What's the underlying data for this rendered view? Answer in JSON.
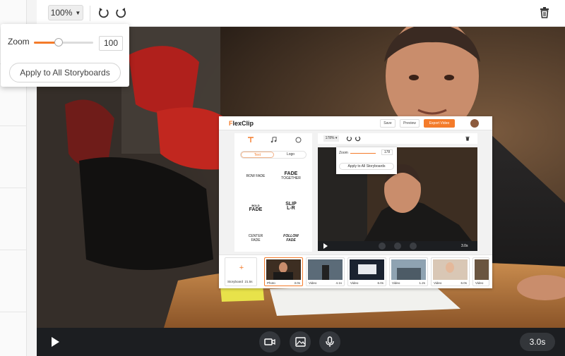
{
  "toolbar": {
    "zoom_display": "100%",
    "undo_icon": "undo-icon",
    "redo_icon": "redo-icon",
    "delete_icon": "trash-icon"
  },
  "zoom_popup": {
    "label": "Zoom",
    "value": "100",
    "slider_level": 0.42,
    "apply_label": "Apply to All Storyboards"
  },
  "controls": {
    "play_icon": "play-icon",
    "video_icon": "video-camera-icon",
    "image_icon": "image-icon",
    "mic_icon": "microphone-icon",
    "duration": "3.0s"
  },
  "mini_app": {
    "logo": "lexClip",
    "logo_f": "F",
    "save": "Save",
    "preview": "Preview",
    "export": "Export Video",
    "tab_text": "Text",
    "tab_logo": "Logo",
    "effects": [
      {
        "top": "",
        "main": "ROW FADE"
      },
      {
        "top": "FADE",
        "main": "TOGETHER"
      },
      {
        "top": "BOLD",
        "main": "FADE"
      },
      {
        "top": "SLIP",
        "main": "L-R"
      },
      {
        "top": "CENTER",
        "main": "FADE"
      },
      {
        "top": "FOLLOW",
        "main": "FADE"
      }
    ],
    "zoom_display": "178%",
    "zoom_label": "Zoom",
    "zoom_value": "178",
    "apply_label": "Apply to All Storyboards",
    "video_duration": "3.0s",
    "storyboard_label": "Storyboard",
    "storyboard_total": "21.5s",
    "clips": [
      {
        "type": "Photo",
        "duration": "3.0s"
      },
      {
        "type": "Video",
        "duration": "4.1s"
      },
      {
        "type": "Video",
        "duration": "6.0s"
      },
      {
        "type": "Video",
        "duration": "1.2s"
      },
      {
        "type": "Video",
        "duration": "6.0s"
      },
      {
        "type": "Video",
        "duration": ""
      }
    ]
  },
  "colors": {
    "accent": "#f47b2a",
    "control_bar": "#1c1e21"
  }
}
